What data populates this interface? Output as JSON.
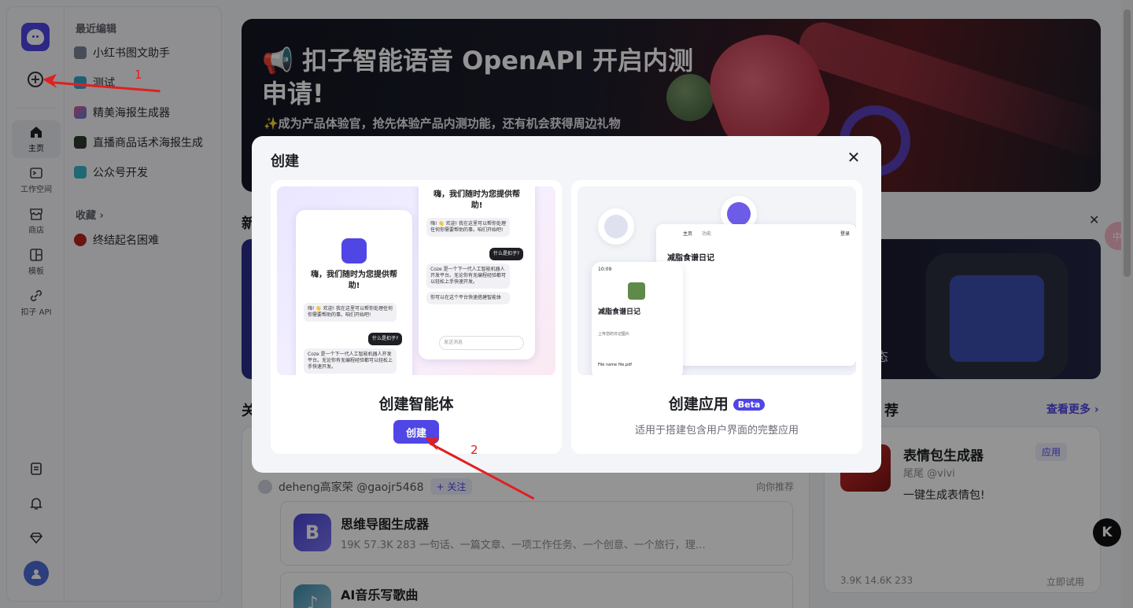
{
  "rail": {
    "items": [
      {
        "label": "主页"
      },
      {
        "label": "工作空间"
      },
      {
        "label": "商店"
      },
      {
        "label": "模板"
      },
      {
        "label": "扣子 API"
      }
    ]
  },
  "panel": {
    "recent_heading": "最近编辑",
    "recent": [
      {
        "label": "小红书图文助手"
      },
      {
        "label": "测试"
      },
      {
        "label": "精美海报生成器"
      },
      {
        "label": "直播商品话术海报生成"
      },
      {
        "label": "公众号开发"
      }
    ],
    "favorites_heading": "收藏",
    "favorites": [
      {
        "label": "终结起名困难"
      }
    ]
  },
  "banner": {
    "title": "扣子智能语音 OpenAPI 开启内测申请!",
    "subtitle": "✨成为产品体验官，抢先体验产品内测功能，还有机会获得周边礼物"
  },
  "sections": {
    "new_title": "新",
    "follow_title": "关",
    "recommend_title": "荐",
    "see_more": "查看更多",
    "dark_card_tail": "态"
  },
  "feed": {
    "author": "deheng高家荣 @gaojr5468",
    "follow_label": "+ 关注",
    "recommend_label": "向你推荐",
    "items": [
      {
        "name": "思维导图生成器",
        "icon": "B",
        "stats": "19K   57.3K   283    一句话、一篇文章、一项工作任务、一个创意、一个旅行，理…"
      },
      {
        "name": "AI音乐写歌曲",
        "icon": "♪",
        "stats": ""
      }
    ]
  },
  "right_card": {
    "name": "表情包生成器",
    "author": "尾尾 @vivi",
    "desc": "一键生成表情包!",
    "badge": "应用",
    "stats": "3.9K     14.6K     233",
    "try": "立即试用"
  },
  "modal": {
    "title": "创建",
    "agent": {
      "name": "创建智能体",
      "button": "创建",
      "preview": {
        "hi": "嗨，我们随时为您提供帮助!",
        "greet": "嗨! 👋 欢迎! 我在这里可以帮你处理任何你需要帮助的事。咱们开始吧!",
        "q": "什么是扣子?",
        "a": "Coze 是一个下一代人工智能机器人开发平台。无论你有无编程经验都可以轻松上手快速开发。",
        "tip": "你可以在这个平台快速搭建智能体",
        "input": "发送消息"
      }
    },
    "app": {
      "name": "创建应用",
      "beta": "Beta",
      "desc": "适用于搭建包含用户界面的完整应用",
      "preview": {
        "title": "减脂食谱日记",
        "tab1": "主页",
        "tab2": "功能",
        "login": "登录",
        "upload": "上传您的日记图片",
        "file": "File name file.pdf",
        "time": "10:09"
      }
    }
  },
  "annotations": {
    "one": "1",
    "two": "2"
  },
  "floating": {
    "k": "K",
    "translate": "中A"
  },
  "colors": {
    "accent": "#4f46e5",
    "annotation": "#e02020"
  }
}
